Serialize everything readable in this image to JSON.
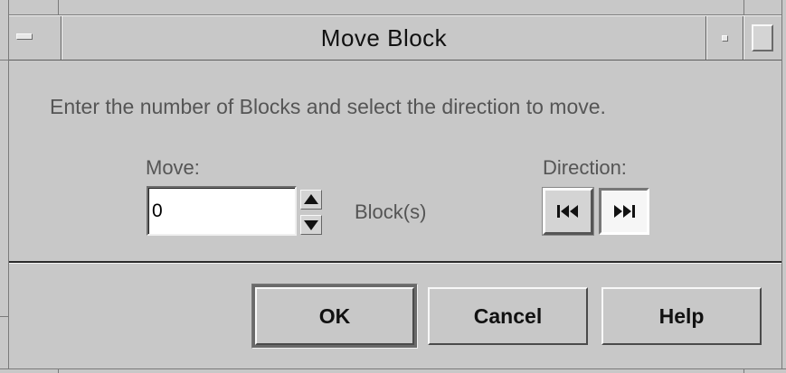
{
  "window": {
    "title": "Move Block"
  },
  "dialog": {
    "instructions": "Enter the number of Blocks and select the direction to move.",
    "move_label": "Move:",
    "move_value": "0",
    "unit_label": "Block(s)",
    "direction_label": "Direction:",
    "direction_buttons": [
      {
        "icon": "skip-backward-icon",
        "selected": false
      },
      {
        "icon": "skip-forward-icon",
        "selected": true
      }
    ]
  },
  "buttons": {
    "ok_label": "OK",
    "cancel_label": "Cancel",
    "help_label": "Help"
  }
}
